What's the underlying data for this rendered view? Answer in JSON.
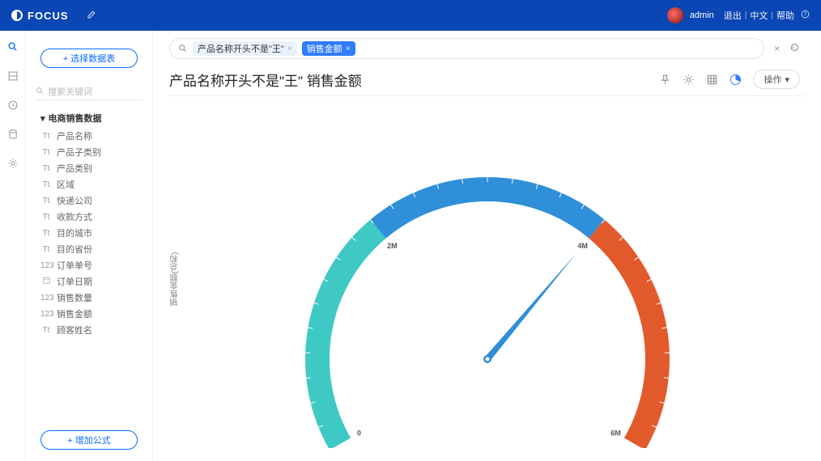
{
  "topbar": {
    "brand": "FOCUS",
    "user": "admin",
    "links": {
      "logout": "退出",
      "lang": "中文",
      "help": "帮助"
    }
  },
  "sidebar": {
    "select_table_btn": "+ 选择数据表",
    "field_search_placeholder": "搜索关键词",
    "group_name": "电商销售数据",
    "fields": [
      {
        "icon": "Tt",
        "label": "产品名称"
      },
      {
        "icon": "Tt",
        "label": "产品子类别"
      },
      {
        "icon": "Tt",
        "label": "产品类别"
      },
      {
        "icon": "Tt",
        "label": "区域"
      },
      {
        "icon": "Tt",
        "label": "快递公司"
      },
      {
        "icon": "Tt",
        "label": "收款方式"
      },
      {
        "icon": "Tt",
        "label": "目的城市"
      },
      {
        "icon": "Tt",
        "label": "目的省份"
      },
      {
        "icon": "123",
        "label": "订单单号"
      },
      {
        "icon": "cal",
        "label": "订单日期"
      },
      {
        "icon": "123",
        "label": "销售数量"
      },
      {
        "icon": "123",
        "label": "销售金额"
      },
      {
        "icon": "Tt",
        "label": "顾客姓名"
      }
    ],
    "add_formula_btn": "+ 增加公式"
  },
  "query": {
    "raw_chip": "产品名称开头不是\"王\"",
    "metric_chip": "销售金额"
  },
  "title": "产品名称开头不是\"王\" 销售金额",
  "ops_label": "操作",
  "chart_data": {
    "type": "gauge",
    "ylabel": "销售金额(总和)",
    "min": 0,
    "max": 6000000,
    "value": 4000000,
    "ticks": [
      {
        "v": 0,
        "label": "0"
      },
      {
        "v": 2000000,
        "label": "2M"
      },
      {
        "v": 4000000,
        "label": "4M"
      },
      {
        "v": 6000000,
        "label": "6M"
      }
    ],
    "segments": [
      {
        "from": 0,
        "to": 2000000,
        "color": "#3fc9c4"
      },
      {
        "from": 2000000,
        "to": 4000000,
        "color": "#2f8fd8"
      },
      {
        "from": 4000000,
        "to": 6000000,
        "color": "#e25a2b"
      }
    ]
  }
}
